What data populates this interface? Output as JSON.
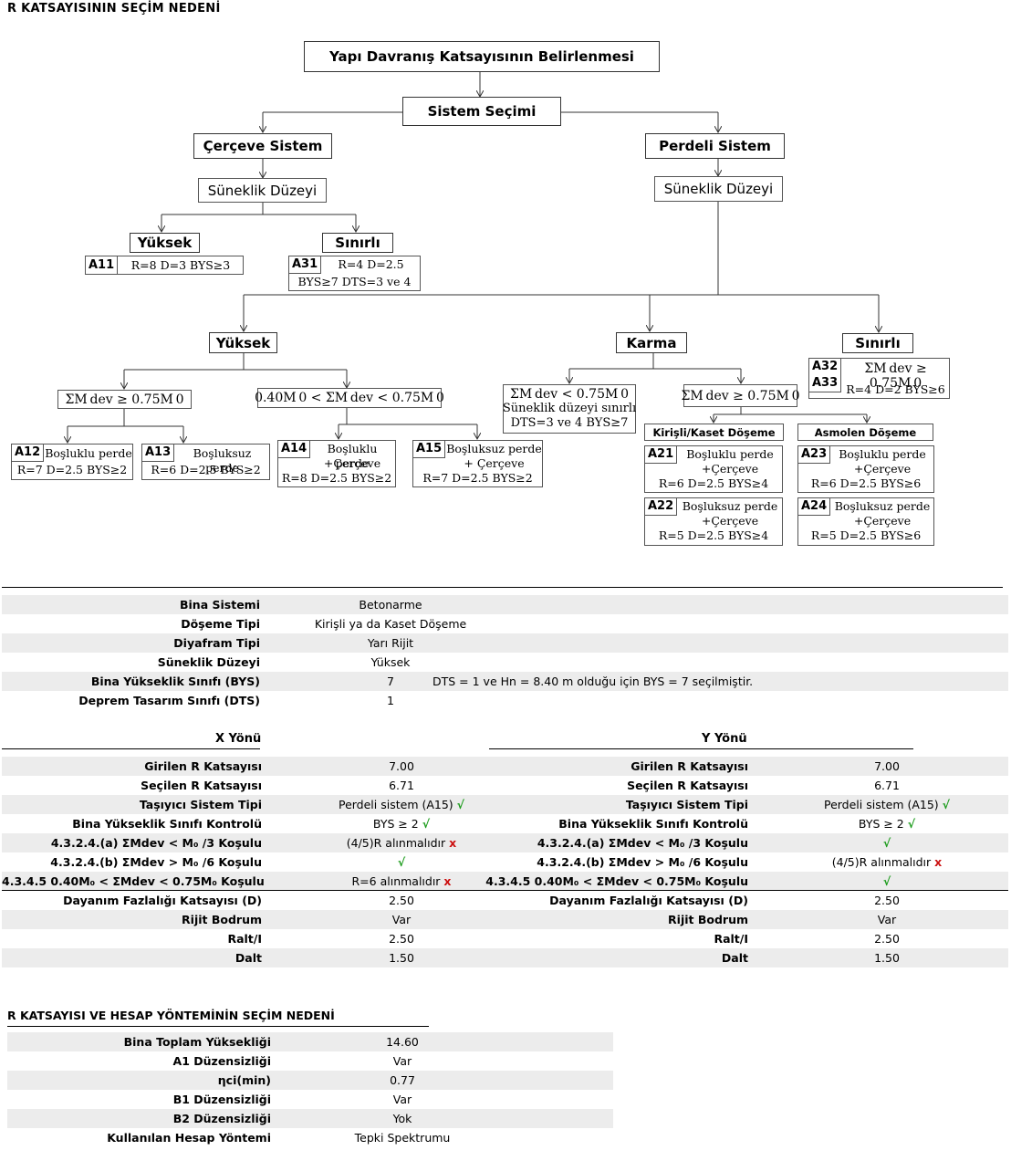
{
  "title": "R KATSAYISININ SEÇİM NEDENİ",
  "flow": {
    "root": "Yapı Davranış Katsayısının Belirlenmesi",
    "system_select": "Sistem Seçimi",
    "frame_system": "Çerçeve Sistem",
    "wall_system": "Perdeli Sistem",
    "ductility": "Süneklik Düzeyi",
    "high": "Yüksek",
    "limited": "Sınırlı",
    "mixed": "Karma",
    "A11": {
      "code": "A11",
      "text": "R=8  D=3  BYS≥3"
    },
    "A31": {
      "code": "A31",
      "line1": "R=4  D=2.5",
      "line2": "BYS≥7 DTS=3 ve 4"
    },
    "A32": {
      "code": "A32"
    },
    "A33": {
      "code": "A33",
      "text": "R=4  D=2 BYS≥6"
    },
    "cond_ge": "ΣM dev ≥ 0.75M 0",
    "cond_mid": "0.40M 0 < ΣM dev < 0.75M 0",
    "cond_lt": "ΣM dev < 0.75M 0",
    "cond_lt_l2": "Süneklik düzeyi sınırlı",
    "cond_lt_l3": "DTS=3 ve 4 BYS≥7",
    "kirisli": "Kirişli/Kaset Döşeme",
    "asmolen": "Asmolen Döşeme",
    "A12": {
      "code": "A12",
      "l1": "Boşluklu perde",
      "l2": "R=7 D=2.5 BYS≥2"
    },
    "A13": {
      "code": "A13",
      "l1": "Boşluksuz perde",
      "l2": "R=6 D=2.5 BYS≥2"
    },
    "A14": {
      "code": "A14",
      "l1": "Boşluklu perde",
      "l2": "+Çerçeve",
      "l3": "R=8 D=2.5 BYS≥2"
    },
    "A15": {
      "code": "A15",
      "l1": "Boşluksuz perde",
      "l2": "+ Çerçeve",
      "l3": "R=7 D=2.5 BYS≥2"
    },
    "A21": {
      "code": "A21",
      "l1": "Boşluklu perde",
      "l2": "+Çerçeve",
      "l3": "R=6 D=2.5 BYS≥4"
    },
    "A22": {
      "code": "A22",
      "l1": "Boşluksuz perde",
      "l2": "+Çerçeve",
      "l3": "R=5 D=2.5 BYS≥4"
    },
    "A23": {
      "code": "A23",
      "l1": "Boşluklu perde",
      "l2": "+Çerçeve",
      "l3": "R=6 D=2.5 BYS≥6"
    },
    "A24": {
      "code": "A24",
      "l1": "Boşluksuz perde",
      "l2": "+Çerçeve",
      "l3": "R=5 D=2.5 BYS≥6"
    }
  },
  "building": [
    {
      "label": "Bina Sistemi",
      "value": "Betonarme"
    },
    {
      "label": "Döşeme Tipi",
      "value": "Kirişli ya da Kaset Döşeme"
    },
    {
      "label": "Diyafram Tipi",
      "value": "Yarı Rijit"
    },
    {
      "label": "Süneklik Düzeyi",
      "value": "Yüksek"
    },
    {
      "label": "Bina Yükseklik Sınıfı (BYS)",
      "value": "7",
      "note": "DTS = 1 ve Hn = 8.40 m olduğu için  BYS = 7 seçilmiştir."
    },
    {
      "label": "Deprem Tasarım Sınıfı (DTS)",
      "value": "1"
    }
  ],
  "x_header": "X Yönü",
  "y_header": "Y Yönü",
  "check_mark": "√",
  "cross_mark": "x",
  "directions": {
    "labels": [
      "Girilen R Katsayısı",
      "Seçilen R Katsayısı",
      "Taşıyıcı Sistem Tipi",
      "Bina Yükseklik Sınıfı Kontrolü",
      "4.3.2.4.(a) ΣMdev < M₀ /3 Koşulu",
      "4.3.2.4.(b) ΣMdev > M₀ /6 Koşulu",
      "4.3.4.5 0.40M₀  < ΣMdev < 0.75M₀  Koşulu",
      "Dayanım Fazlalığı Katsayısı (D)",
      "Rijit Bodrum",
      "Ralt/I",
      "Dalt"
    ],
    "x": [
      {
        "text": "7.00"
      },
      {
        "text": "6.71"
      },
      {
        "text": "Perdeli sistem (A15) ",
        "mark": "ok"
      },
      {
        "text": "BYS ≥ 2 ",
        "mark": "ok"
      },
      {
        "text": "(4/5)R alınmalıdır ",
        "mark": "no"
      },
      {
        "text": "",
        "mark": "ok"
      },
      {
        "text": "R=6 alınmalıdır ",
        "mark": "no"
      },
      {
        "text": "2.50"
      },
      {
        "text": "Var"
      },
      {
        "text": "2.50"
      },
      {
        "text": "1.50"
      }
    ],
    "y": [
      {
        "text": "7.00"
      },
      {
        "text": "6.71"
      },
      {
        "text": "Perdeli sistem (A15) ",
        "mark": "ok"
      },
      {
        "text": "BYS ≥ 2 ",
        "mark": "ok"
      },
      {
        "text": "",
        "mark": "ok"
      },
      {
        "text": "(4/5)R alınmalıdır ",
        "mark": "no"
      },
      {
        "text": "",
        "mark": "ok"
      },
      {
        "text": "2.50"
      },
      {
        "text": "Var"
      },
      {
        "text": "2.50"
      },
      {
        "text": "1.50"
      }
    ]
  },
  "section2_title": "R KATSAYISI VE HESAP YÖNTEMİNİN SEÇİM NEDENİ",
  "section2": [
    {
      "label": "Bina Toplam Yüksekliği",
      "value": "14.60"
    },
    {
      "label": "A1 Düzensizliği",
      "value": "Var"
    },
    {
      "label": "ηci(min)",
      "value": "0.77"
    },
    {
      "label": "B1 Düzensizliği",
      "value": "Var"
    },
    {
      "label": "B2 Düzensizliği",
      "value": "Yok"
    },
    {
      "label": "Kullanılan Hesap Yöntemi",
      "value": "Tepki Spektrumu"
    }
  ]
}
